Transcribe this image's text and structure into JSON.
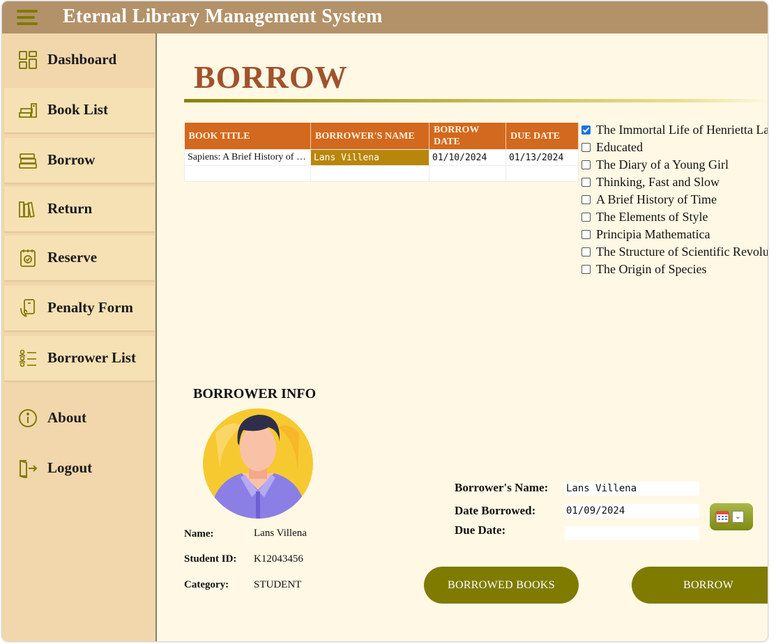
{
  "app": {
    "title": "Eternal Library Management System"
  },
  "colors": {
    "titlebar": "#b3926a",
    "sidebar": "#f1d7ab",
    "accent": "#7f7b00",
    "page_title": "#a0522d",
    "table_header": "#d2691e"
  },
  "sidebar": {
    "items": [
      {
        "label": "Dashboard",
        "icon": "dashboard-icon"
      },
      {
        "label": "Book List",
        "icon": "books-stack-icon"
      },
      {
        "label": "Borrow",
        "icon": "book-stack-icon"
      },
      {
        "label": "Return",
        "icon": "bookshelf-icon"
      },
      {
        "label": "Reserve",
        "icon": "clipboard-check-icon"
      },
      {
        "label": "Penalty Form",
        "icon": "hand-phone-icon"
      },
      {
        "label": "Borrower List",
        "icon": "user-list-icon"
      },
      {
        "label": "About",
        "icon": "info-icon"
      },
      {
        "label": "Logout",
        "icon": "logout-icon"
      }
    ]
  },
  "page": {
    "title": "BORROW"
  },
  "table": {
    "headers": [
      "BOOK TITLE",
      "BORROWER'S NAME",
      "BORROW DATE",
      "DUE DATE"
    ],
    "rows": [
      [
        "Sapiens: A Brief History of Humankind",
        "Lans Villena",
        "01/10/2024",
        "01/13/2024"
      ],
      [
        "",
        "",
        "",
        ""
      ]
    ]
  },
  "books": [
    {
      "title": "The Immortal Life of Henrietta Lacks",
      "checked": true
    },
    {
      "title": "Educated",
      "checked": false
    },
    {
      "title": "The Diary of a Young Girl",
      "checked": false
    },
    {
      "title": "Thinking, Fast and Slow",
      "checked": false
    },
    {
      "title": "A Brief History of Time",
      "checked": false
    },
    {
      "title": "The Elements of Style",
      "checked": false
    },
    {
      "title": "Principia Mathematica",
      "checked": false
    },
    {
      "title": "The Structure of Scientific Revolutions",
      "checked": false
    },
    {
      "title": "The Origin of Species",
      "checked": false
    }
  ],
  "borrower_info": {
    "heading": "BORROWER INFO",
    "name_label": "Name:",
    "name": "Lans Villena",
    "id_label": "Student ID:",
    "id": "K12043456",
    "category_label": "Category:",
    "category": "STUDENT"
  },
  "form": {
    "name_label": "Borrower's Name:",
    "name_value": "Lans Villena",
    "date_label": "Date Borrowed:",
    "date_value": "01/09/2024",
    "due_label": "Due Date:",
    "due_value": ""
  },
  "buttons": {
    "borrowed_books": "BORROWED BOOKS",
    "borrow": "BORROW"
  }
}
